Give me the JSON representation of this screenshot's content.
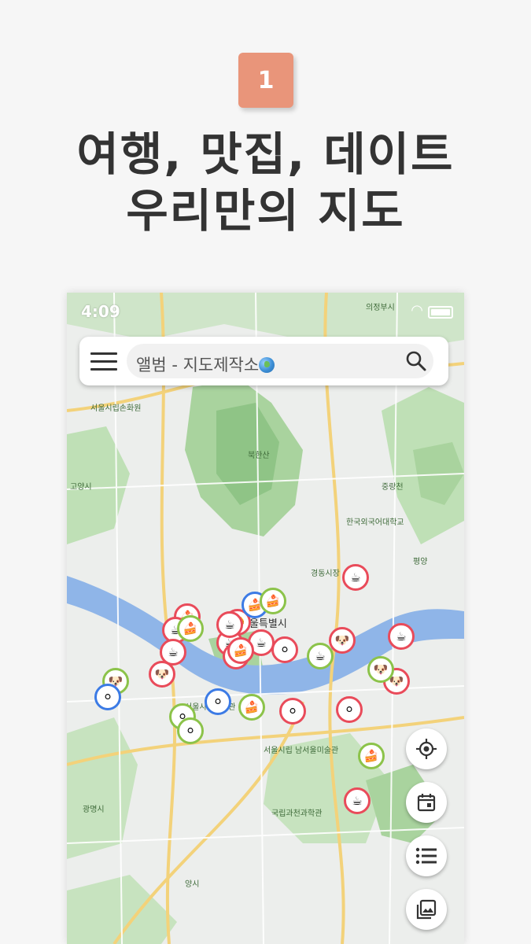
{
  "badge": {
    "number": "1"
  },
  "headline": {
    "line1": "여행, 맛집, 데이트",
    "line2": "우리만의 지도"
  },
  "status": {
    "time": "4:09"
  },
  "search": {
    "text": "앨범 - 지도제작소"
  },
  "map_labels": {
    "l1": "의정부시",
    "l2": "서울시립손화원",
    "l3": "서울특별시",
    "l4": "광명시",
    "l5": "양시",
    "l6": "한국외국어대학교",
    "l7": "중랑천",
    "l8": "북한산",
    "l9": "경동시장",
    "l10": "서울시립 남서울미술관",
    "l11": "국립과천과학관",
    "l12": "고양시",
    "l13": "서울시립미술관",
    "l14": "평양"
  },
  "markers": [
    {
      "kind": "cake",
      "ring": "red"
    },
    {
      "kind": "coffee",
      "ring": "red"
    },
    {
      "kind": "dog",
      "ring": "green"
    },
    {
      "kind": "ball",
      "ring": "blue"
    },
    {
      "kind": "cake",
      "ring": "green"
    },
    {
      "kind": "coffee",
      "ring": "red"
    },
    {
      "kind": "shrimp",
      "ring": "red"
    },
    {
      "kind": "ball",
      "ring": "green"
    },
    {
      "kind": "dog",
      "ring": "red"
    },
    {
      "kind": "coffee",
      "ring": "red"
    },
    {
      "kind": "cake",
      "ring": "blue"
    },
    {
      "kind": "coffee",
      "ring": "red"
    },
    {
      "kind": "ball",
      "ring": "red"
    },
    {
      "kind": "dog",
      "ring": "red"
    },
    {
      "kind": "coffee",
      "ring": "green"
    },
    {
      "kind": "cake",
      "ring": "green"
    },
    {
      "kind": "coffee",
      "ring": "red"
    },
    {
      "kind": "dog",
      "ring": "red"
    },
    {
      "kind": "cake",
      "ring": "green"
    },
    {
      "kind": "coffee",
      "ring": "red"
    },
    {
      "kind": "ball",
      "ring": "red"
    },
    {
      "kind": "coffee",
      "ring": "red"
    },
    {
      "kind": "cake",
      "ring": "green"
    },
    {
      "kind": "ball",
      "ring": "green"
    },
    {
      "kind": "ball",
      "ring": "red"
    },
    {
      "kind": "dog",
      "ring": "green"
    },
    {
      "kind": "coffee",
      "ring": "red"
    },
    {
      "kind": "cake",
      "ring": "red"
    },
    {
      "kind": "coffee",
      "ring": "red"
    },
    {
      "kind": "ball",
      "ring": "blue"
    }
  ],
  "colors": {
    "accent": "#e9957a",
    "ring_red": "#e94b5a",
    "ring_green": "#8cc34a",
    "ring_blue": "#3c7be5",
    "river": "#8fb5e8"
  },
  "icons": [
    "menu-icon",
    "search-icon",
    "globe-icon",
    "locate-icon",
    "calendar-icon",
    "list-icon",
    "gallery-icon"
  ]
}
